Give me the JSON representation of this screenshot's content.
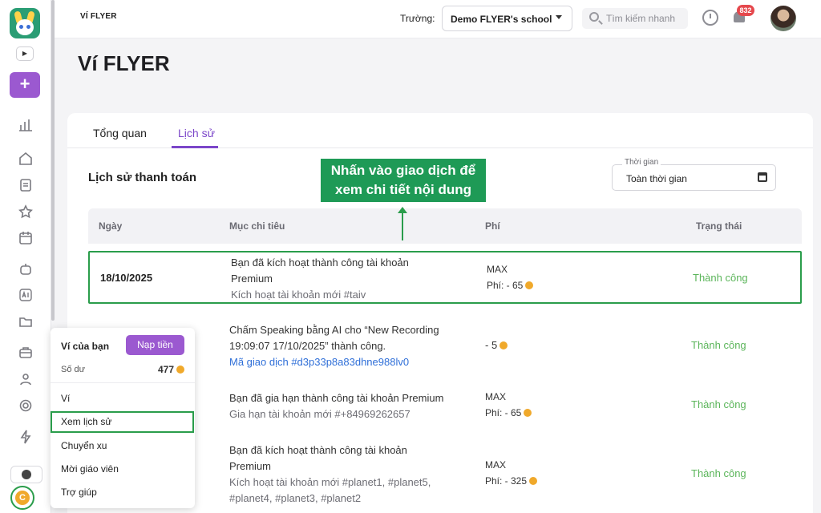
{
  "app": {
    "name": "VÍ FLYER",
    "page_title": "Ví FLYER"
  },
  "header": {
    "school_label": "Trường:",
    "school_value": "Demo FLYER's school",
    "search_placeholder": "Tìm kiếm nhanh",
    "notification_count": "832"
  },
  "tabs": [
    {
      "label": "Tổng quan",
      "active": false
    },
    {
      "label": "Lịch sử",
      "active": true
    }
  ],
  "section": {
    "title": "Lịch sử thanh toán",
    "time_label": "Thời gian",
    "time_value": "Toàn thời gian"
  },
  "table": {
    "columns": [
      "Ngày",
      "Mục chi tiêu",
      "Phí",
      "Trạng thái"
    ],
    "rows": [
      {
        "date": "18/10/2025",
        "line1": "Bạn đã kích hoạt thành công tài khoản",
        "line2": "Premium",
        "sub": "Kích hoạt tài khoản mới #taiv",
        "fee_top": "MAX",
        "fee": "Phí: - 65",
        "status": "Thành công"
      },
      {
        "date": "",
        "line1": "Chấm Speaking bằng AI cho “New Recording",
        "line2": "19:09:07 17/10/2025” thành công.",
        "link": "Mã giao dịch #d3p33p8a83dhne988lv0",
        "fee": "- 5",
        "status": "Thành công"
      },
      {
        "date": "",
        "line1": "Bạn đã gia hạn thành công tài khoản Premium",
        "sub": "Gia hạn tài khoản mới #+84969262657",
        "fee_top": "MAX",
        "fee": "Phí: - 65",
        "status": "Thành công"
      },
      {
        "date": "",
        "line1": "Bạn đã kích hoạt thành công tài khoản",
        "line2": "Premium",
        "sub": "Kích hoạt tài khoản mới #planet1, #planet5,",
        "sub2": "#planet4, #planet3, #planet2",
        "fee_top": "MAX",
        "fee": "Phí: - 325",
        "status": "Thành công"
      }
    ]
  },
  "callout": {
    "line1": "Nhấn vào giao dịch để",
    "line2": "xem chi tiết nội dung"
  },
  "wallet": {
    "title": "Ví của bạn",
    "topup": "Nạp tiền",
    "balance_label": "Số dư",
    "balance": "477",
    "items": [
      "Ví",
      "Xem lịch sử",
      "Chuyển xu",
      "Mời giáo viên",
      "Trợ giúp"
    ]
  },
  "rail": {
    "mini": "▶",
    "add": "+",
    "coin": "C"
  },
  "colors": {
    "accent": "#9b59d0",
    "success": "#5bb55a",
    "highlight": "#2a9d4b",
    "coin": "#f0a92b"
  }
}
